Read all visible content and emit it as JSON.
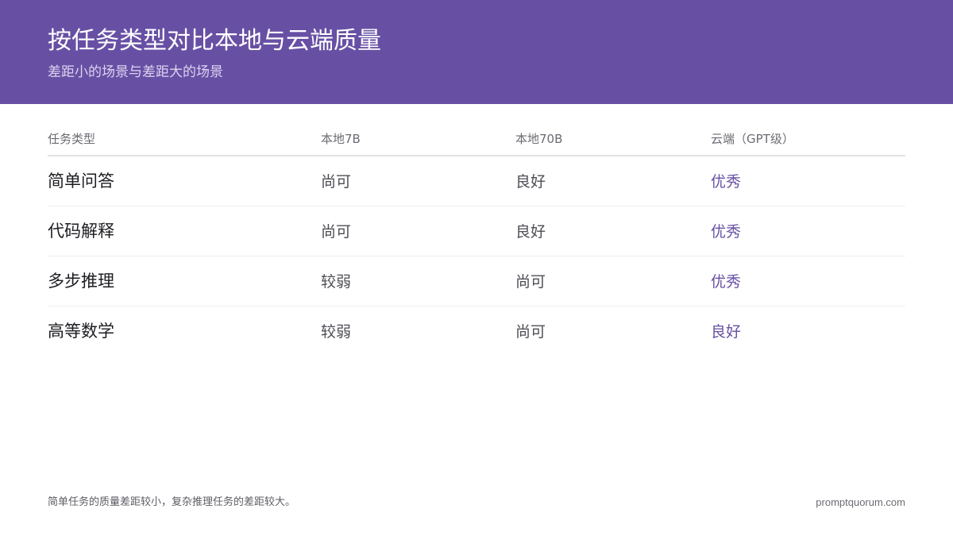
{
  "header": {
    "title": "按任务类型对比本地与云端质量",
    "subtitle": "差距小的场景与差距大的场景"
  },
  "table": {
    "columns": [
      "任务类型",
      "本地7B",
      "本地70B",
      "云端（GPT级）"
    ],
    "rows": [
      [
        "简单问答",
        "尚可",
        "良好",
        "优秀"
      ],
      [
        "代码解释",
        "尚可",
        "良好",
        "优秀"
      ],
      [
        "多步推理",
        "较弱",
        "尚可",
        "优秀"
      ],
      [
        "高等数学",
        "较弱",
        "尚可",
        "良好"
      ]
    ]
  },
  "footer": {
    "note": "简单任务的质量差距较小，复杂推理任务的差距较大。",
    "site": "promptquorum.com"
  },
  "colors": {
    "accent": "#6750a4"
  }
}
